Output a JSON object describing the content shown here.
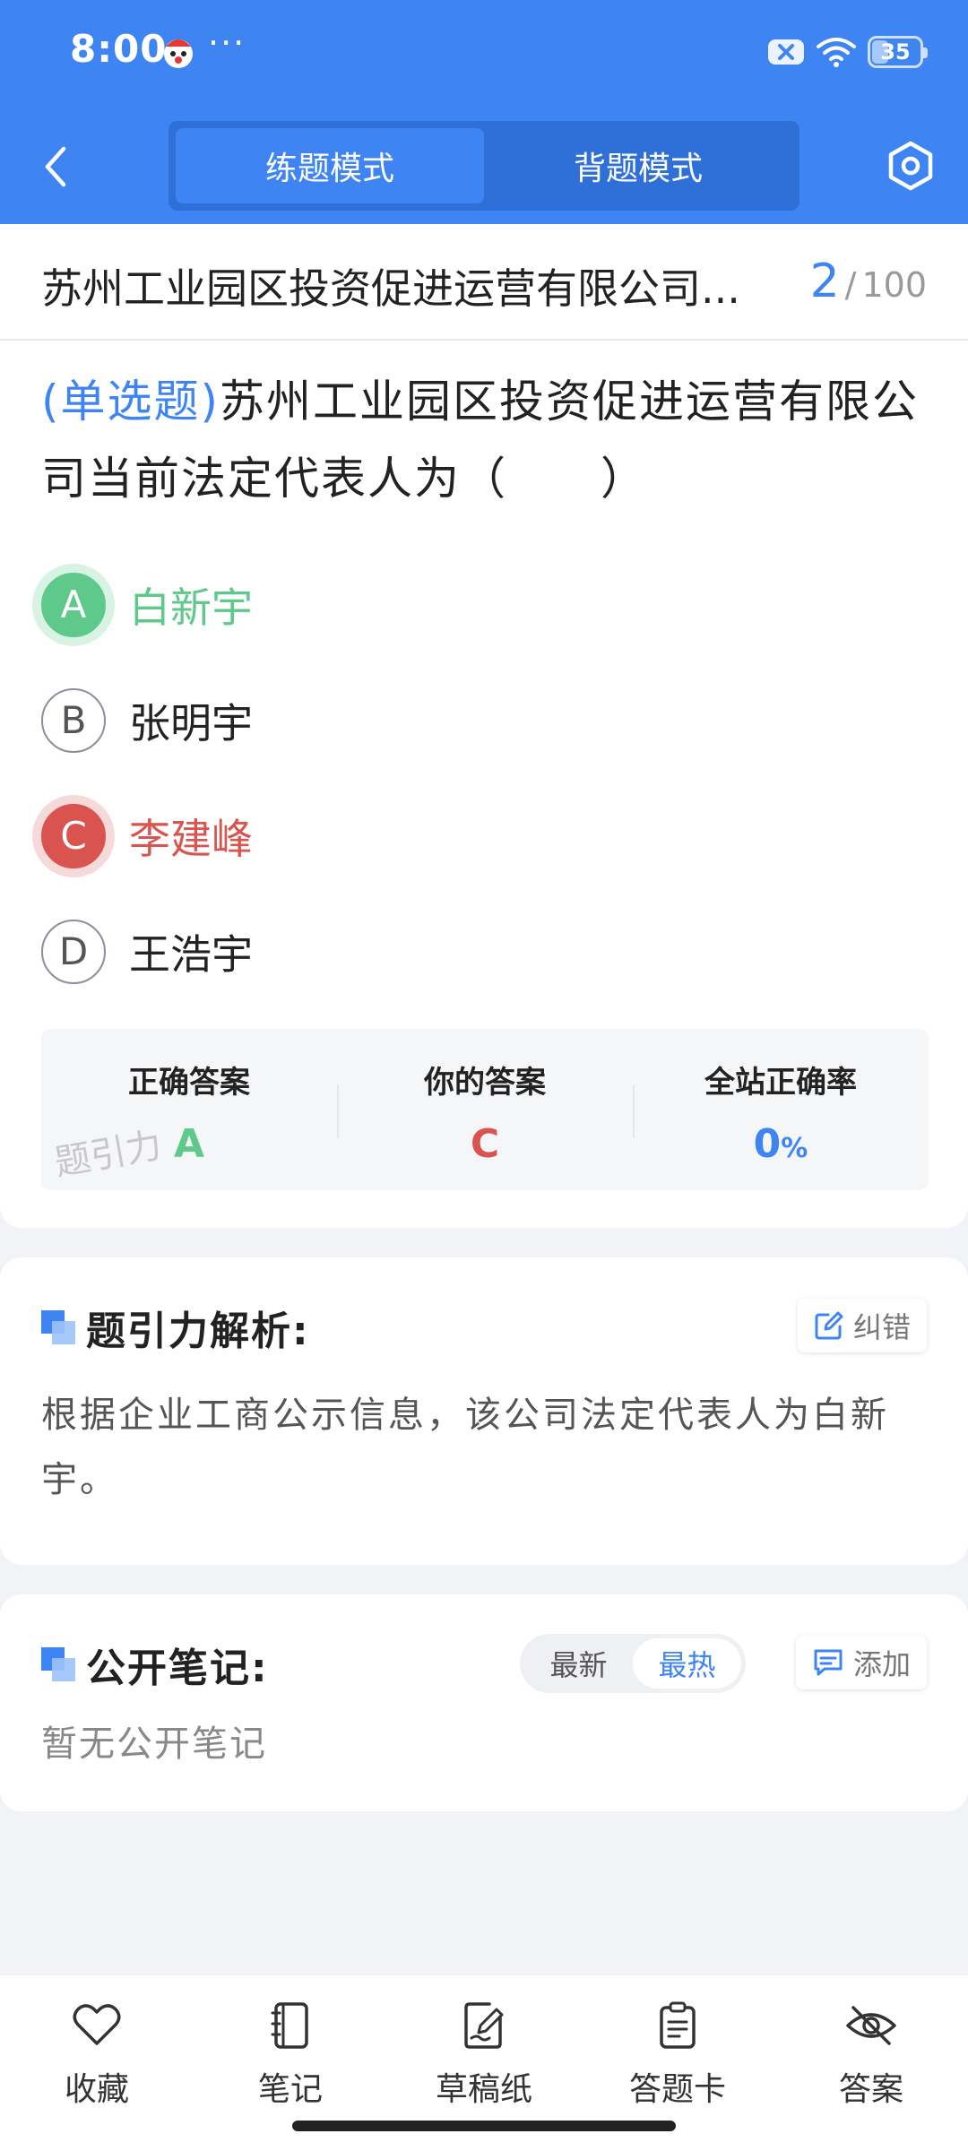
{
  "status_bar": {
    "time": "8:00",
    "more": "···",
    "battery": "35"
  },
  "header": {
    "tabs": [
      {
        "label": "练题模式",
        "active": true
      },
      {
        "label": "背题模式",
        "active": false
      }
    ]
  },
  "title_row": {
    "title": "苏州工业园区投资促进运营有限公司...",
    "current": "2",
    "total": "100"
  },
  "question": {
    "type": "(单选题)",
    "text": "苏州工业园区投资促进运营有限公司当前法定代表人为（　　）"
  },
  "options": [
    {
      "key": "A",
      "text": "白新宇",
      "state": "correct"
    },
    {
      "key": "B",
      "text": "张明宇",
      "state": "normal"
    },
    {
      "key": "C",
      "text": "李建峰",
      "state": "wrong"
    },
    {
      "key": "D",
      "text": "王浩宇",
      "state": "normal"
    }
  ],
  "answer_summary": {
    "correct_label": "正确答案",
    "correct_value": "A",
    "yours_label": "你的答案",
    "yours_value": "C",
    "rate_label": "全站正确率",
    "rate_value": "0",
    "rate_unit": "%",
    "watermark": "题引力"
  },
  "analysis": {
    "title": "题引力解析:",
    "report_label": "纠错",
    "text": "根据企业工商公示信息，该公司法定代表人为白新宇。"
  },
  "notes": {
    "title": "公开笔记:",
    "sort_options": [
      "最新",
      "最热"
    ],
    "sort_active": "最热",
    "add_label": "添加",
    "empty_text": "暂无公开笔记"
  },
  "bottom_bar": [
    {
      "label": "收藏",
      "icon": "heart-icon"
    },
    {
      "label": "笔记",
      "icon": "notebook-icon"
    },
    {
      "label": "草稿纸",
      "icon": "draft-paper-icon"
    },
    {
      "label": "答题卡",
      "icon": "answer-sheet-icon"
    },
    {
      "label": "答案",
      "icon": "eye-off-icon"
    }
  ],
  "colors": {
    "primary": "#3e85f3",
    "correct": "#5ec98a",
    "wrong": "#d9534f"
  }
}
